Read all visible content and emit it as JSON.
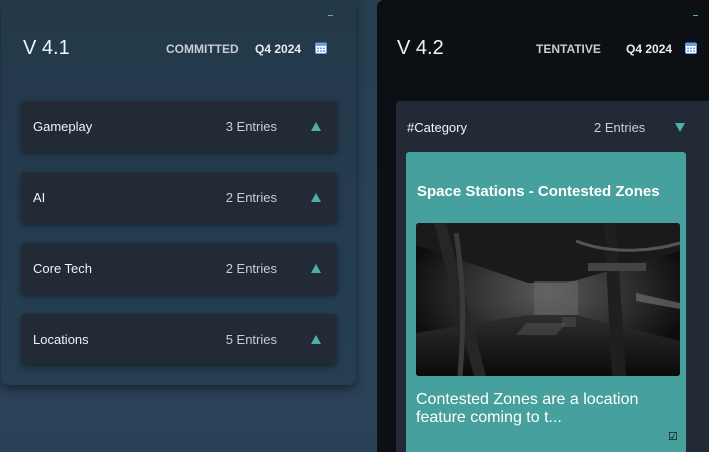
{
  "columns": [
    {
      "version": "V 4.1",
      "status": "COMMITTED",
      "date": "Q4 2024",
      "categories": [
        {
          "name": "Gameplay",
          "count": "3 Entries"
        },
        {
          "name": "AI",
          "count": "2 Entries"
        },
        {
          "name": "Core Tech",
          "count": "2 Entries"
        },
        {
          "name": "Locations",
          "count": "5 Entries"
        }
      ]
    },
    {
      "version": "V 4.2",
      "status": "TENTATIVE",
      "date": "Q4 2024",
      "panel": {
        "category": "#Category",
        "count": "2 Entries",
        "card": {
          "title": "Space Stations - Contested Zones",
          "description": "Contested Zones are a location feature coming to t..."
        }
      }
    }
  ],
  "icons": {
    "calendar": "calendar-icon",
    "expand": "triangle-up-icon",
    "collapse": "triangle-down-icon",
    "check": "checkbox-icon"
  },
  "colors": {
    "accent": "#52aca9",
    "card": "#46a09e",
    "calendar": "#6ea0e0"
  }
}
